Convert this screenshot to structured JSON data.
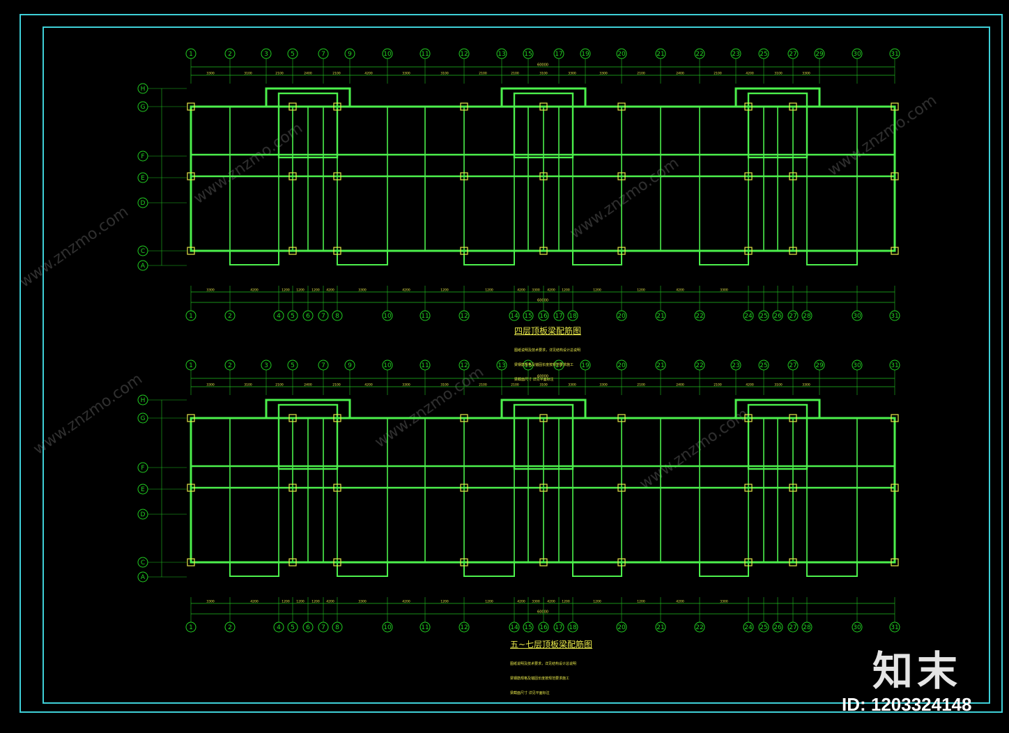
{
  "colors": {
    "frame": "#3fd0d8",
    "grid": "#20c020",
    "wall": "#4cf04c",
    "text": "#e8e84a",
    "axis": "#22d022",
    "watermark": "#8a8a8a"
  },
  "plans": [
    {
      "title": "四层顶板梁配筋图",
      "note": [
        "图纸说明及技术要求，详见结构设计总说明",
        "梁钢筋规格及锚固长度按规范要求施工",
        "梁截面尺寸 详见平面标注"
      ]
    },
    {
      "title": "五~七层顶板梁配筋图",
      "note": [
        "图纸说明及技术要求，详见结构设计总说明",
        "梁钢筋规格及锚固长度按规范要求施工",
        "梁截面尺寸 详见平面标注"
      ]
    }
  ],
  "top_axes": [
    "1",
    "2",
    "3",
    "5",
    "7",
    "9",
    "10",
    "11",
    "12",
    "13",
    "15",
    "17",
    "19",
    "20",
    "21",
    "22",
    "23",
    "25",
    "27",
    "29",
    "30",
    "31"
  ],
  "bottom_axes": [
    "1",
    "2",
    "4",
    "5",
    "6",
    "7",
    "8",
    "10",
    "11",
    "12",
    "14",
    "15",
    "16",
    "17",
    "18",
    "20",
    "21",
    "22",
    "24",
    "25",
    "26",
    "27",
    "28",
    "30",
    "31"
  ],
  "row_axes": [
    "H",
    "G",
    "F",
    "E",
    "D",
    "C",
    "A"
  ],
  "top_dims": [
    "3300",
    "3100",
    "2100",
    "2400",
    "2100",
    "4200",
    "3300",
    "3100",
    "2100",
    "2100",
    "3100",
    "3300",
    "3300",
    "2100",
    "2400",
    "2100",
    "4200",
    "3100",
    "3300"
  ],
  "bottom_dims": [
    "3300",
    "4200",
    "1200",
    "1200",
    "1200",
    "4200",
    "3300",
    "4200",
    "1200",
    "1200",
    "4200",
    "3300",
    "4200",
    "1200",
    "1200",
    "1200",
    "4200",
    "3300"
  ],
  "total_dim": "60000",
  "watermark": "www.znzmo.com",
  "logo": "知末",
  "id_label": "ID: 1203324148"
}
